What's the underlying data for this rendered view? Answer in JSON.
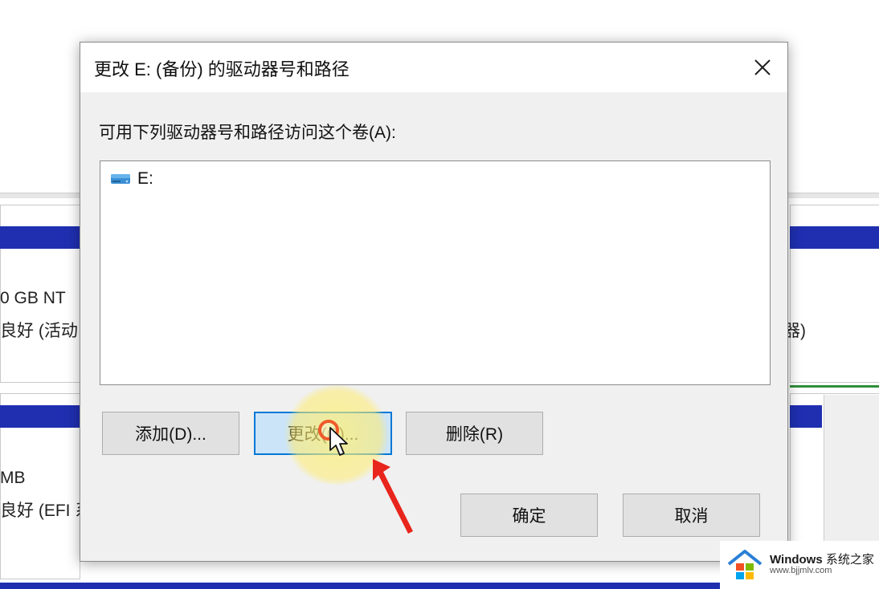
{
  "background": {
    "left_col": {
      "row1_size": "0 GB NT",
      "row1_status": "良好 (活动",
      "row2_size": "MB",
      "row2_status": "良好 (EFI 系"
    },
    "right_col": {
      "row1_status_tail": "器)"
    },
    "colors": {
      "partition_bar": "#1f2fb0",
      "primary_green": "#2f8f3a"
    }
  },
  "dialog": {
    "title": "更改 E: (备份) 的驱动器号和路径",
    "instruction": "可用下列驱动器号和路径访问这个卷(A):",
    "list_items": [
      {
        "label": "E:",
        "icon": "drive-icon"
      }
    ],
    "buttons": {
      "add": "添加(D)...",
      "change": "更改(C)...",
      "remove": "删除(R)",
      "ok": "确定",
      "cancel": "取消"
    },
    "close_icon": "close-icon"
  },
  "overlay": {
    "cursor_icon": "pointer-cursor-icon",
    "arrow_icon": "red-arrow-icon",
    "highlight_color": "#fff178",
    "arrow_color": "#e8251c"
  },
  "watermark": {
    "brand_en": "Windows",
    "brand_cn": "系统之家",
    "url": "www.bjjmlv.com"
  }
}
